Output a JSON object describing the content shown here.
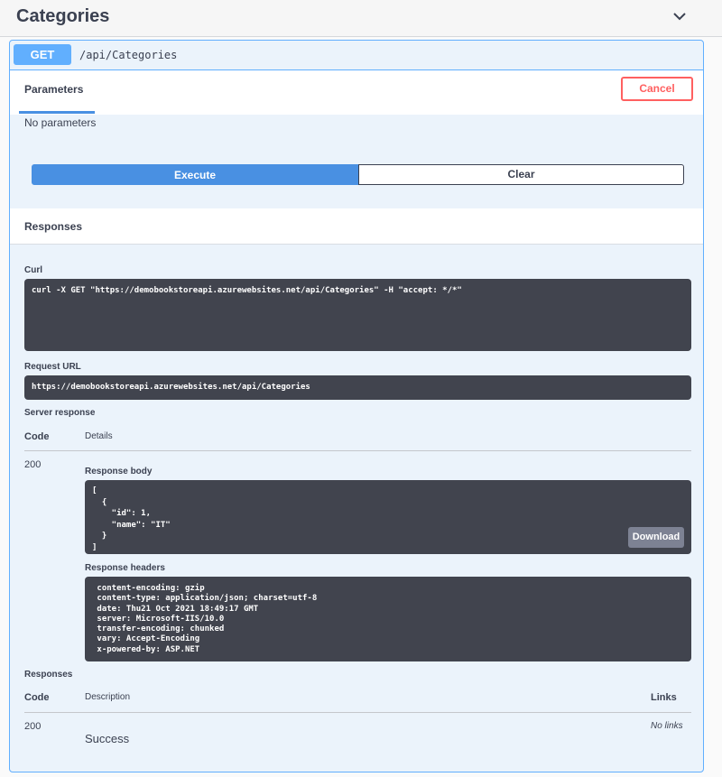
{
  "tag": {
    "title": "Categories",
    "expand_icon": "chevron-down-icon"
  },
  "operation": {
    "method": "GET",
    "path": "/api/Categories",
    "accent_color": "#61affe",
    "tabs": {
      "parameters": "Parameters"
    },
    "cancel_label": "Cancel",
    "no_parameters": "No parameters",
    "execute_label": "Execute",
    "clear_label": "Clear"
  },
  "responses_section": {
    "title": "Responses",
    "curl_label": "Curl",
    "curl_command": "curl -X GET \"https://demobookstoreapi.azurewebsites.net/api/Categories\" -H \"accept: */*\"",
    "request_url_label": "Request URL",
    "request_url": "https://demobookstoreapi.azurewebsites.net/api/Categories",
    "server_response_label": "Server response",
    "code_header": "Code",
    "details_header": "Details",
    "status_code": "200",
    "response_body_label": "Response body",
    "response_body": "[\n  {\n    \"id\": 1,\n    \"name\": \"IT\"\n  }\n]",
    "download_label": "Download",
    "response_headers_label": "Response headers",
    "response_headers": " content-encoding: gzip\n content-type: application/json; charset=utf-8\n date: Thu21 Oct 2021 18:49:17 GMT\n server: Microsoft-IIS/10.0\n transfer-encoding: chunked\n vary: Accept-Encoding\n x-powered-by: ASP.NET"
  },
  "documented_responses": {
    "title": "Responses",
    "code_header": "Code",
    "description_header": "Description",
    "links_header": "Links",
    "rows": [
      {
        "code": "200",
        "description": "Success",
        "links": "No links"
      }
    ]
  }
}
